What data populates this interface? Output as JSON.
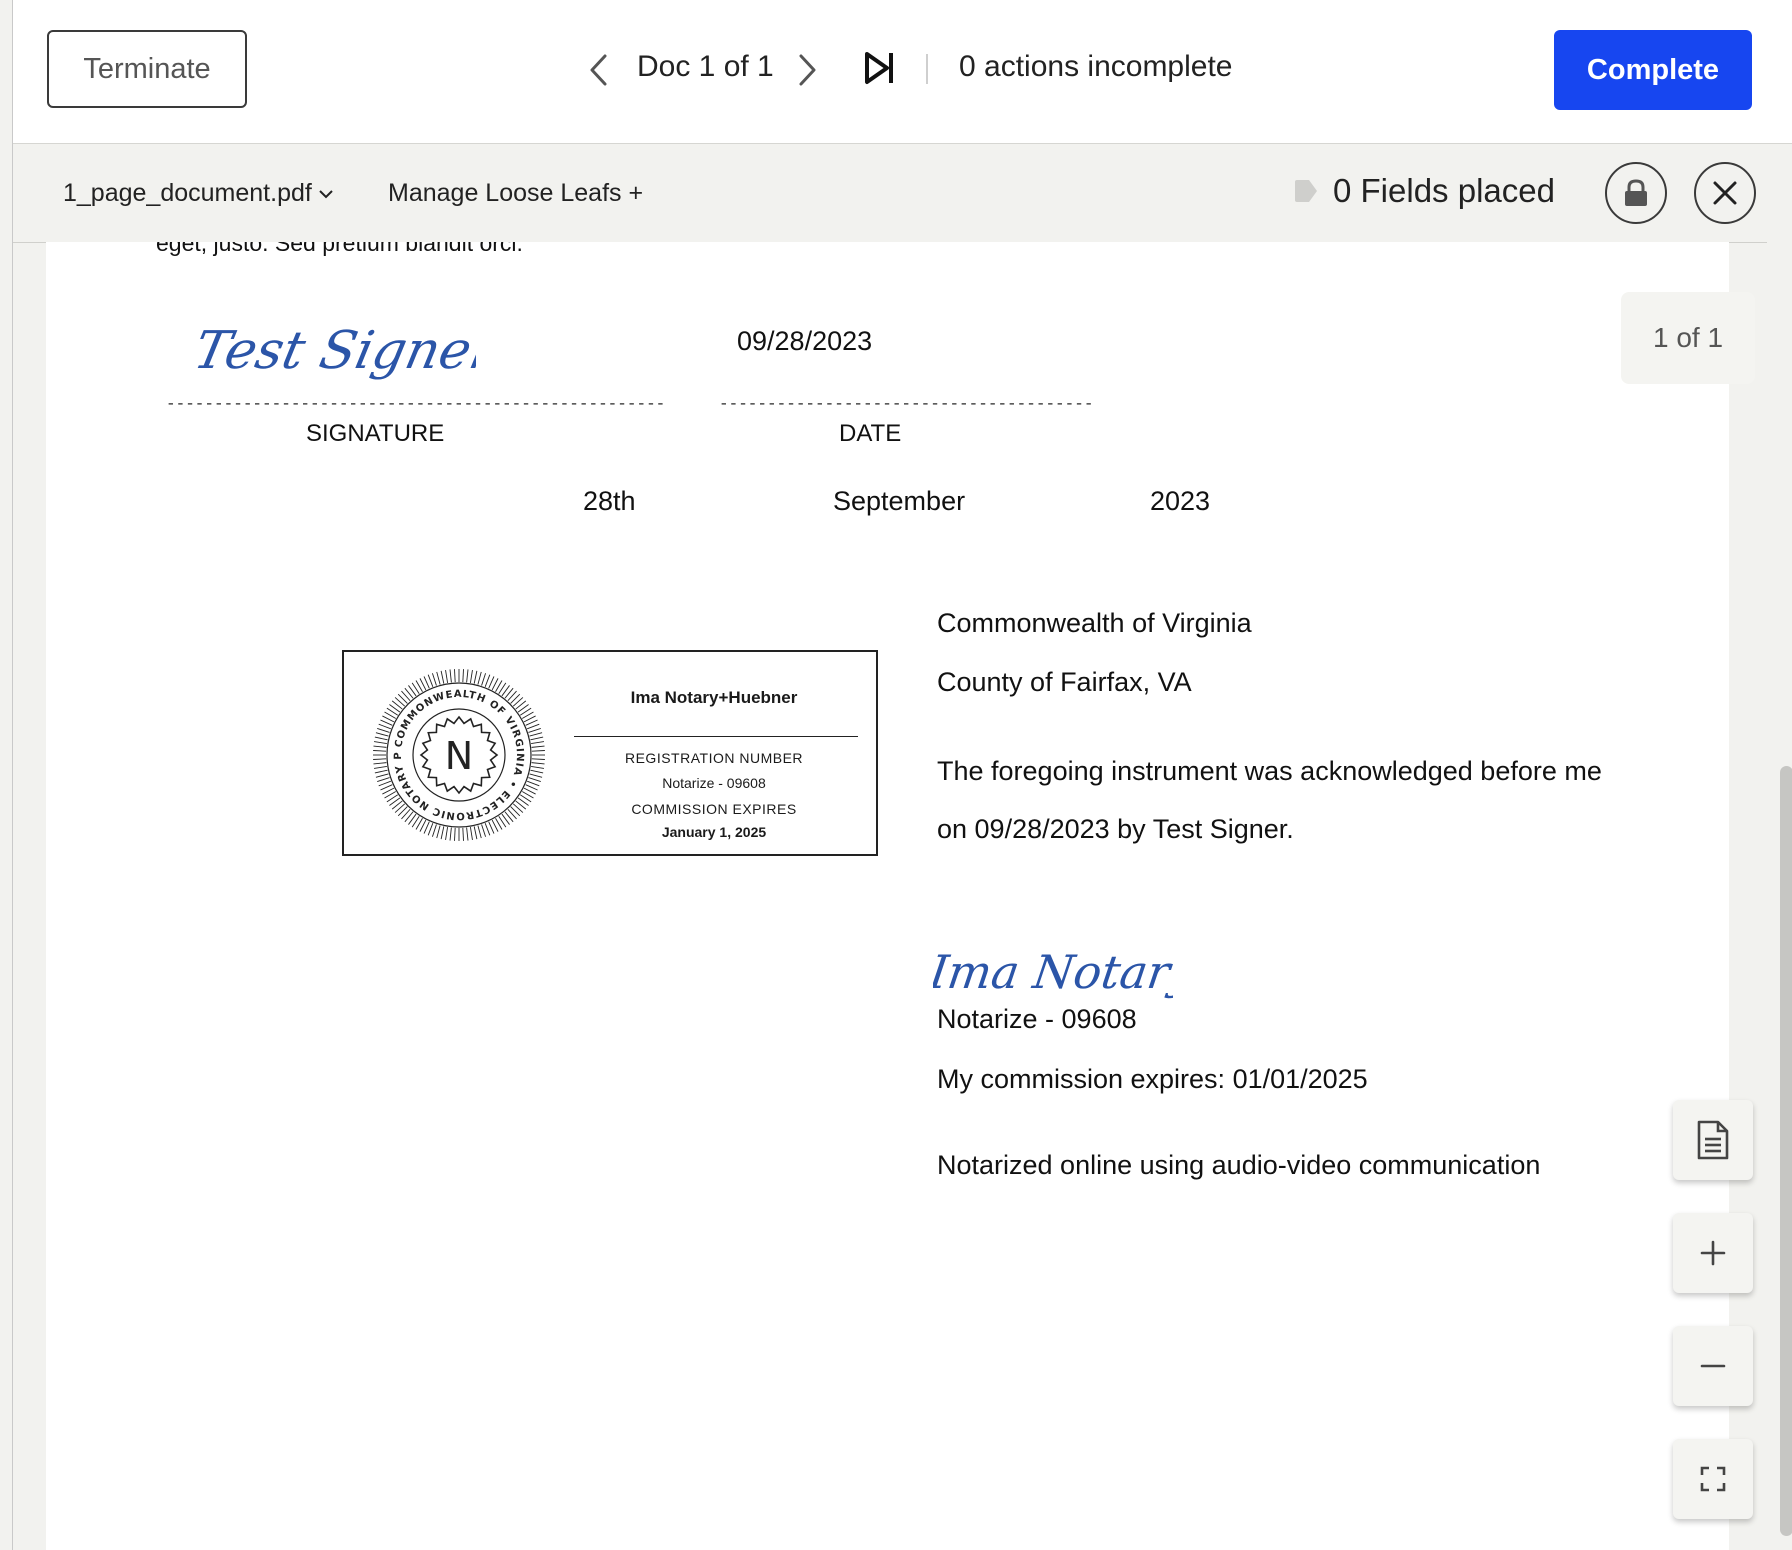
{
  "topbar": {
    "terminate_label": "Terminate",
    "doc_counter": "Doc 1 of 1",
    "actions_status": "0 actions incomplete",
    "complete_label": "Complete"
  },
  "subbar": {
    "file_name": "1_page_document.pdf",
    "loose_leafs_label": "Manage Loose Leafs +",
    "fields_placed": "0 Fields placed"
  },
  "document": {
    "cut_line": "eget, justo. Sed pretium blandit orci.",
    "signature_date": "09/28/2023",
    "signature_dashes": "----------------------------------------------------",
    "date_dashes": "---------------------------------------",
    "signature_label": "SIGNATURE",
    "date_label": "DATE",
    "day": "28th",
    "month": "September",
    "year": "2023",
    "venue_state": "Commonwealth of Virginia",
    "venue_county": "County of Fairfax, VA",
    "ack_line1": "The foregoing instrument was acknowledged before me",
    "ack_line2": "on 09/28/2023 by Test Signer.",
    "notary_id": "Notarize - 09608",
    "commission_line": "My commission expires: 01/01/2025",
    "online_line": "Notarized online using audio-video communication",
    "signer_signature": "Test Signer",
    "notary_signature": "Ima Notary"
  },
  "seal": {
    "notary_name": "Ima Notary+Huebner",
    "registration_label": "REGISTRATION NUMBER",
    "registration_value": "Notarize - 09608",
    "expires_label": "COMMISSION EXPIRES",
    "expires_value": "January 1, 2025",
    "ring_text": "COMMONWEALTH OF VIRGINIA • ELECTRONIC NOTARY PUBLIC •",
    "center_letter": "N"
  },
  "viewer": {
    "page_indicator": "1 of 1"
  },
  "colors": {
    "primary": "#1746f0",
    "signature_ink": "#2b55a8"
  },
  "icons": {
    "prev": "chevron-left-icon",
    "next": "chevron-right-icon",
    "last": "skip-to-end-icon",
    "file_dropdown": "chevron-down-icon",
    "tag": "tag-icon",
    "lock": "lock-icon",
    "close": "close-icon",
    "document": "document-icon",
    "zoom_in": "plus-icon",
    "zoom_out": "minus-icon",
    "fit": "fullscreen-icon"
  }
}
